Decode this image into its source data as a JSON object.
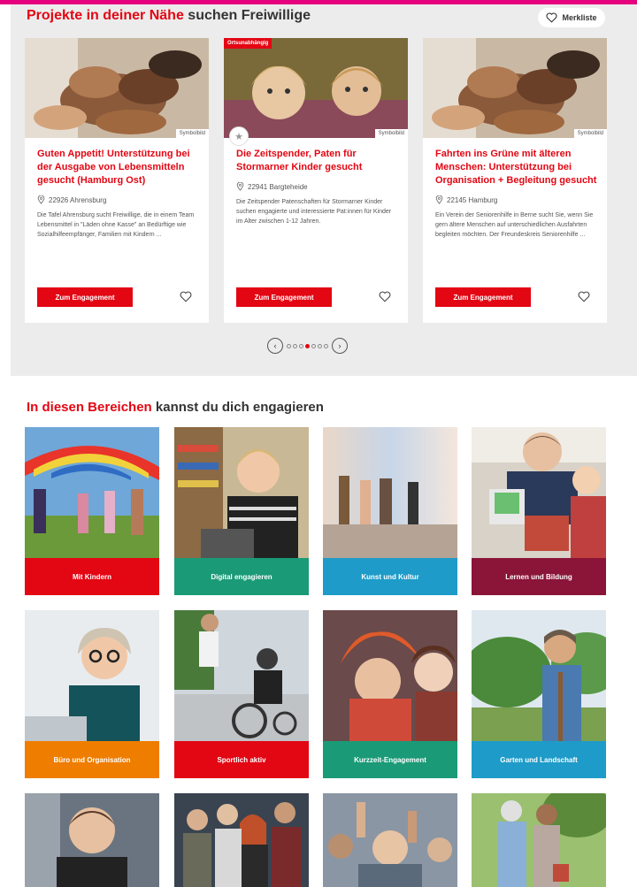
{
  "projects": {
    "title_red": "Projekte in deiner Nähe",
    "title_rest": "suchen Freiwillige",
    "merkliste_label": "Merkliste",
    "cards": [
      {
        "title": "Guten Appetit! Unterstützung bei der Ausgabe von Lebensmitteln gesucht (Hamburg Ost)",
        "location": "22926 Ahrensburg",
        "description": "Die Tafel Ahrensburg sucht Freiwillige, die in einem Team Lebensmittel in \"Läden ohne Kasse\" an Bedürftige wie Sozialhilfeempfänger, Familien mit Kindern ...",
        "image_tag": "Symbolbild",
        "button_label": "Zum Engagement"
      },
      {
        "badge": "Ortsunabhängig",
        "title": "Die Zeitspender, Paten für Stormarner Kinder gesucht",
        "location": "22941 Bargteheide",
        "description": "Die Zeitspender Patenschaften für Stormarner Kinder suchen engagierte und interessierte Pat:innen für Kinder im Alter zwischen 1-12 Jahren.",
        "image_tag": "Symbolbild",
        "button_label": "Zum Engagement"
      },
      {
        "title": "Fahrten ins Grüne mit älteren Menschen: Unterstützung bei Organisation + Begleitung gesucht",
        "location": "22145 Hamburg",
        "description": "Ein Verein der Seniorenhilfe in Berne sucht Sie, wenn Sie gern ältere Menschen auf unterschiedlichen Ausfahrten begleiten möchten. Der Freundeskreis Seniorenhilfe ...",
        "image_tag": "Symbolbild",
        "button_label": "Zum Engagement"
      }
    ],
    "pager": {
      "total": 7,
      "active_index": 3
    }
  },
  "areas": {
    "title_red": "In diesen Bereichen",
    "title_rest": "kannst du dich engagieren",
    "tiles": [
      {
        "label": "Mit Kindern",
        "color": "#e30613"
      },
      {
        "label": "Digital engagieren",
        "color": "#1a9a77"
      },
      {
        "label": "Kunst und Kultur",
        "color": "#1e9bc8"
      },
      {
        "label": "Lernen und Bildung",
        "color": "#8a1538"
      },
      {
        "label": "Büro und Organisation",
        "color": "#ef7d00"
      },
      {
        "label": "Sportlich aktiv",
        "color": "#e30613"
      },
      {
        "label": "Kurzzeit-Engagement",
        "color": "#1a9a77"
      },
      {
        "label": "Garten und Landschaft",
        "color": "#1e9bc8"
      }
    ]
  },
  "colors": {
    "brand_red": "#e30613",
    "accent_pink": "#e6007e",
    "section_bg": "#ececec"
  }
}
